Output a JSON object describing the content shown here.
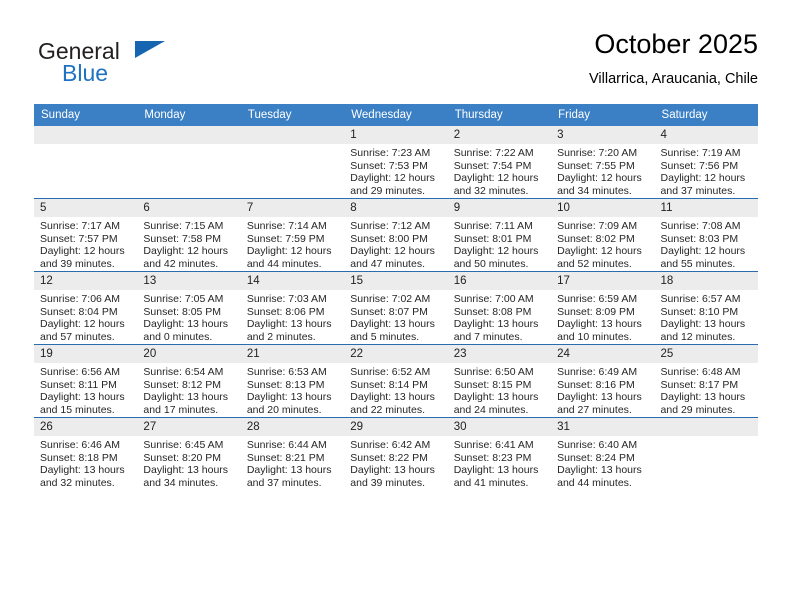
{
  "brand": {
    "name_part1": "General",
    "name_part2": "Blue",
    "triangle_color": "#1565b0",
    "blue_color": "#1f72c2"
  },
  "header": {
    "title": "October 2025",
    "subtitle": "Villarrica, Araucania, Chile"
  },
  "theme": {
    "header_row_bg": "#3b7fc4",
    "day_band_bg": "#ececec",
    "week_divider": "#2a6cb0",
    "text": "#262626"
  },
  "weekday_headers": [
    "Sunday",
    "Monday",
    "Tuesday",
    "Wednesday",
    "Thursday",
    "Friday",
    "Saturday"
  ],
  "labels": {
    "sunrise_prefix": "Sunrise:",
    "sunset_prefix": "Sunset:",
    "daylight_prefix": "Daylight:"
  },
  "weeks": [
    [
      {
        "day": "",
        "empty": true
      },
      {
        "day": "",
        "empty": true
      },
      {
        "day": "",
        "empty": true
      },
      {
        "day": "1",
        "sunrise": "Sunrise: 7:23 AM",
        "sunset": "Sunset: 7:53 PM",
        "daylight_l1": "Daylight: 12 hours",
        "daylight_l2": "and 29 minutes."
      },
      {
        "day": "2",
        "sunrise": "Sunrise: 7:22 AM",
        "sunset": "Sunset: 7:54 PM",
        "daylight_l1": "Daylight: 12 hours",
        "daylight_l2": "and 32 minutes."
      },
      {
        "day": "3",
        "sunrise": "Sunrise: 7:20 AM",
        "sunset": "Sunset: 7:55 PM",
        "daylight_l1": "Daylight: 12 hours",
        "daylight_l2": "and 34 minutes."
      },
      {
        "day": "4",
        "sunrise": "Sunrise: 7:19 AM",
        "sunset": "Sunset: 7:56 PM",
        "daylight_l1": "Daylight: 12 hours",
        "daylight_l2": "and 37 minutes."
      }
    ],
    [
      {
        "day": "5",
        "sunrise": "Sunrise: 7:17 AM",
        "sunset": "Sunset: 7:57 PM",
        "daylight_l1": "Daylight: 12 hours",
        "daylight_l2": "and 39 minutes."
      },
      {
        "day": "6",
        "sunrise": "Sunrise: 7:15 AM",
        "sunset": "Sunset: 7:58 PM",
        "daylight_l1": "Daylight: 12 hours",
        "daylight_l2": "and 42 minutes."
      },
      {
        "day": "7",
        "sunrise": "Sunrise: 7:14 AM",
        "sunset": "Sunset: 7:59 PM",
        "daylight_l1": "Daylight: 12 hours",
        "daylight_l2": "and 44 minutes."
      },
      {
        "day": "8",
        "sunrise": "Sunrise: 7:12 AM",
        "sunset": "Sunset: 8:00 PM",
        "daylight_l1": "Daylight: 12 hours",
        "daylight_l2": "and 47 minutes."
      },
      {
        "day": "9",
        "sunrise": "Sunrise: 7:11 AM",
        "sunset": "Sunset: 8:01 PM",
        "daylight_l1": "Daylight: 12 hours",
        "daylight_l2": "and 50 minutes."
      },
      {
        "day": "10",
        "sunrise": "Sunrise: 7:09 AM",
        "sunset": "Sunset: 8:02 PM",
        "daylight_l1": "Daylight: 12 hours",
        "daylight_l2": "and 52 minutes."
      },
      {
        "day": "11",
        "sunrise": "Sunrise: 7:08 AM",
        "sunset": "Sunset: 8:03 PM",
        "daylight_l1": "Daylight: 12 hours",
        "daylight_l2": "and 55 minutes."
      }
    ],
    [
      {
        "day": "12",
        "sunrise": "Sunrise: 7:06 AM",
        "sunset": "Sunset: 8:04 PM",
        "daylight_l1": "Daylight: 12 hours",
        "daylight_l2": "and 57 minutes."
      },
      {
        "day": "13",
        "sunrise": "Sunrise: 7:05 AM",
        "sunset": "Sunset: 8:05 PM",
        "daylight_l1": "Daylight: 13 hours",
        "daylight_l2": "and 0 minutes."
      },
      {
        "day": "14",
        "sunrise": "Sunrise: 7:03 AM",
        "sunset": "Sunset: 8:06 PM",
        "daylight_l1": "Daylight: 13 hours",
        "daylight_l2": "and 2 minutes."
      },
      {
        "day": "15",
        "sunrise": "Sunrise: 7:02 AM",
        "sunset": "Sunset: 8:07 PM",
        "daylight_l1": "Daylight: 13 hours",
        "daylight_l2": "and 5 minutes."
      },
      {
        "day": "16",
        "sunrise": "Sunrise: 7:00 AM",
        "sunset": "Sunset: 8:08 PM",
        "daylight_l1": "Daylight: 13 hours",
        "daylight_l2": "and 7 minutes."
      },
      {
        "day": "17",
        "sunrise": "Sunrise: 6:59 AM",
        "sunset": "Sunset: 8:09 PM",
        "daylight_l1": "Daylight: 13 hours",
        "daylight_l2": "and 10 minutes."
      },
      {
        "day": "18",
        "sunrise": "Sunrise: 6:57 AM",
        "sunset": "Sunset: 8:10 PM",
        "daylight_l1": "Daylight: 13 hours",
        "daylight_l2": "and 12 minutes."
      }
    ],
    [
      {
        "day": "19",
        "sunrise": "Sunrise: 6:56 AM",
        "sunset": "Sunset: 8:11 PM",
        "daylight_l1": "Daylight: 13 hours",
        "daylight_l2": "and 15 minutes."
      },
      {
        "day": "20",
        "sunrise": "Sunrise: 6:54 AM",
        "sunset": "Sunset: 8:12 PM",
        "daylight_l1": "Daylight: 13 hours",
        "daylight_l2": "and 17 minutes."
      },
      {
        "day": "21",
        "sunrise": "Sunrise: 6:53 AM",
        "sunset": "Sunset: 8:13 PM",
        "daylight_l1": "Daylight: 13 hours",
        "daylight_l2": "and 20 minutes."
      },
      {
        "day": "22",
        "sunrise": "Sunrise: 6:52 AM",
        "sunset": "Sunset: 8:14 PM",
        "daylight_l1": "Daylight: 13 hours",
        "daylight_l2": "and 22 minutes."
      },
      {
        "day": "23",
        "sunrise": "Sunrise: 6:50 AM",
        "sunset": "Sunset: 8:15 PM",
        "daylight_l1": "Daylight: 13 hours",
        "daylight_l2": "and 24 minutes."
      },
      {
        "day": "24",
        "sunrise": "Sunrise: 6:49 AM",
        "sunset": "Sunset: 8:16 PM",
        "daylight_l1": "Daylight: 13 hours",
        "daylight_l2": "and 27 minutes."
      },
      {
        "day": "25",
        "sunrise": "Sunrise: 6:48 AM",
        "sunset": "Sunset: 8:17 PM",
        "daylight_l1": "Daylight: 13 hours",
        "daylight_l2": "and 29 minutes."
      }
    ],
    [
      {
        "day": "26",
        "sunrise": "Sunrise: 6:46 AM",
        "sunset": "Sunset: 8:18 PM",
        "daylight_l1": "Daylight: 13 hours",
        "daylight_l2": "and 32 minutes."
      },
      {
        "day": "27",
        "sunrise": "Sunrise: 6:45 AM",
        "sunset": "Sunset: 8:20 PM",
        "daylight_l1": "Daylight: 13 hours",
        "daylight_l2": "and 34 minutes."
      },
      {
        "day": "28",
        "sunrise": "Sunrise: 6:44 AM",
        "sunset": "Sunset: 8:21 PM",
        "daylight_l1": "Daylight: 13 hours",
        "daylight_l2": "and 37 minutes."
      },
      {
        "day": "29",
        "sunrise": "Sunrise: 6:42 AM",
        "sunset": "Sunset: 8:22 PM",
        "daylight_l1": "Daylight: 13 hours",
        "daylight_l2": "and 39 minutes."
      },
      {
        "day": "30",
        "sunrise": "Sunrise: 6:41 AM",
        "sunset": "Sunset: 8:23 PM",
        "daylight_l1": "Daylight: 13 hours",
        "daylight_l2": "and 41 minutes."
      },
      {
        "day": "31",
        "sunrise": "Sunrise: 6:40 AM",
        "sunset": "Sunset: 8:24 PM",
        "daylight_l1": "Daylight: 13 hours",
        "daylight_l2": "and 44 minutes."
      },
      {
        "day": "",
        "empty": true
      }
    ]
  ]
}
